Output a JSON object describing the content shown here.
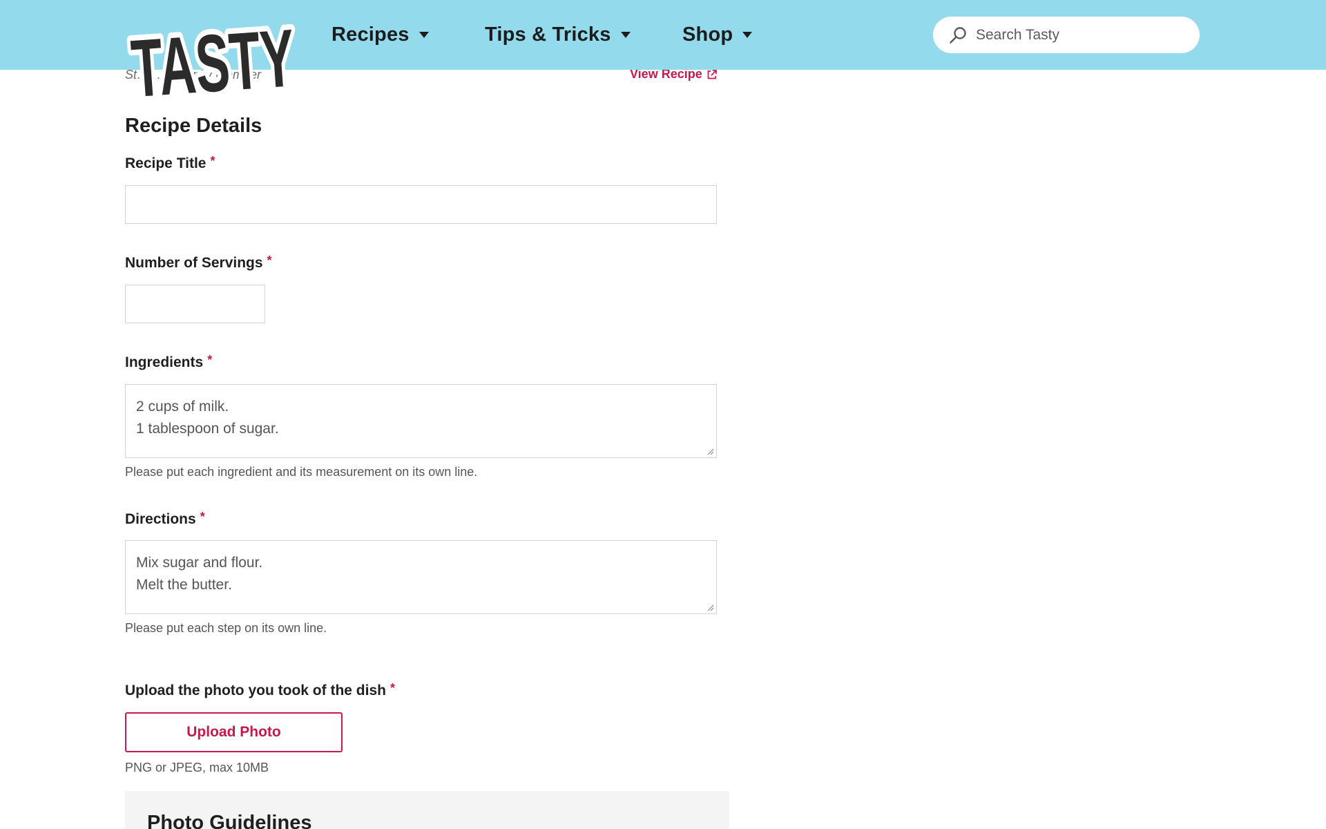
{
  "header": {
    "logo_text": "TASTY",
    "nav": [
      {
        "label": "Recipes"
      },
      {
        "label": "Tips & Tricks"
      },
      {
        "label": "Shop"
      }
    ],
    "search": {
      "placeholder": "Search Tasty",
      "value": ""
    },
    "colors": {
      "background": "#93dbec",
      "text": "#1c1c1c"
    }
  },
  "attribution": {
    "left_text": "St…              …mmunity Member",
    "view_recipe_label": "View Recipe"
  },
  "form": {
    "section_title": "Recipe Details",
    "required_marker": "*",
    "recipe_title": {
      "label": "Recipe Title",
      "value": ""
    },
    "servings": {
      "label": "Number of Servings",
      "value": ""
    },
    "ingredients": {
      "label": "Ingredients",
      "placeholder_lines": [
        "2 cups of milk.",
        "1 tablespoon of sugar."
      ],
      "hint": "Please put each ingredient and its measurement on its own line."
    },
    "directions": {
      "label": "Directions",
      "placeholder_lines": [
        "Mix sugar and flour.",
        "Melt the butter."
      ],
      "hint": "Please put each step on its own line."
    },
    "photo": {
      "label": "Upload the photo you took of the dish",
      "button_label": "Upload Photo",
      "hint": "PNG or JPEG, max 10MB"
    },
    "guidelines_title": "Photo Guidelines"
  },
  "colors": {
    "accent": "#c8174a",
    "border": "#d3d3d3",
    "panel": "#f4f4f4"
  }
}
